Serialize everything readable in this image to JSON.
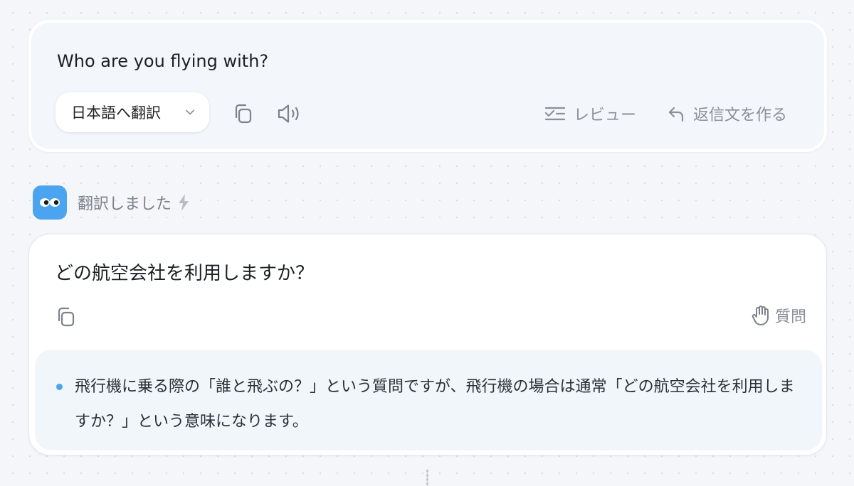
{
  "source": {
    "text": "Who are you flying with?",
    "language_button": "日本語へ翻訳",
    "actions": {
      "review_label": "レビュー",
      "reply_label": "返信文を作る"
    },
    "icons": [
      "copy-icon",
      "speaker-icon",
      "review-icon",
      "reply-icon",
      "chevron-down-icon"
    ]
  },
  "status": {
    "label": "翻訳しました",
    "icons": [
      "bot-avatar-icon",
      "lightning-icon"
    ]
  },
  "translation": {
    "text": "どの航空会社を利用しますか？",
    "question_label": "質問",
    "explanation": "飛行機に乗る際の「誰と飛ぶの？」という質問ですが、飛行機の場合は通常「どの航空会社を利用しますか？」という意味になります。",
    "icons": [
      "copy-icon",
      "hand-icon"
    ]
  },
  "colors": {
    "accent": "#4aa4f0",
    "muted_text": "#8a8f99",
    "background": "#f4f6f9"
  }
}
